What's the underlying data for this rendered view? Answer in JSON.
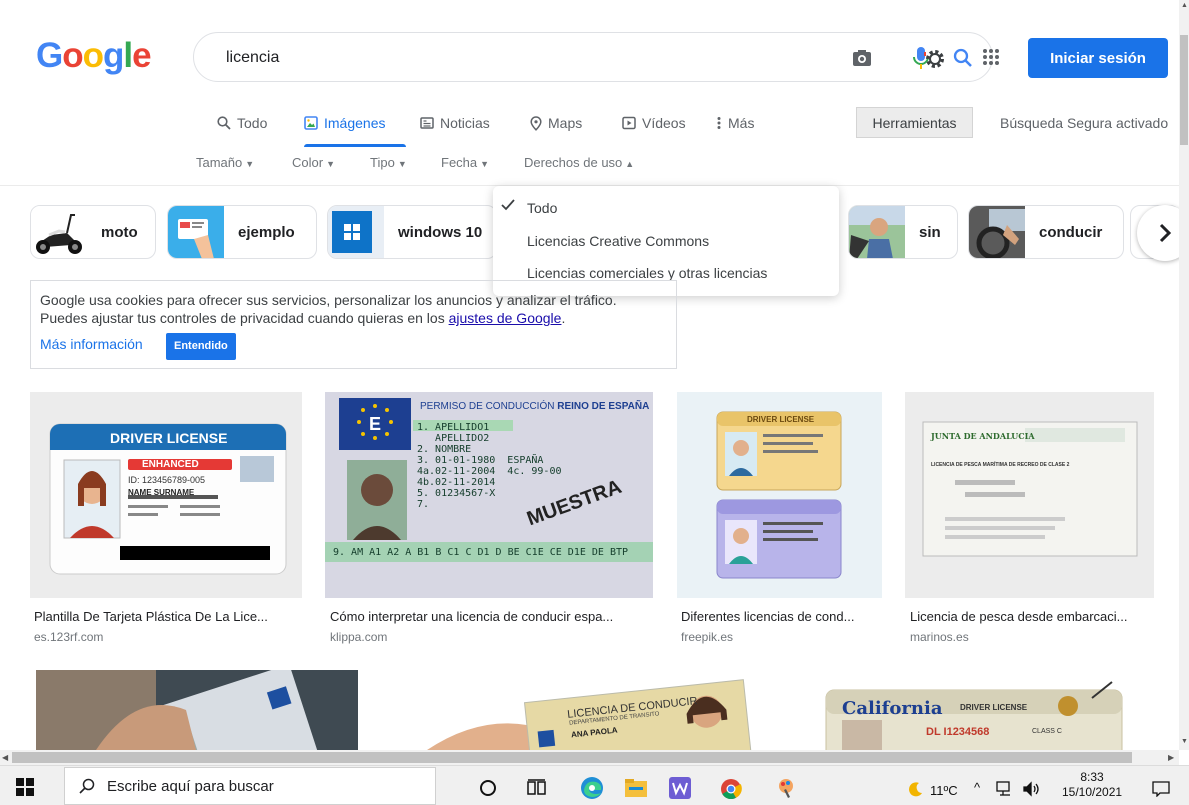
{
  "header": {
    "logo_text": "Google",
    "search_value": "licencia",
    "signin_label": "Iniciar sesión"
  },
  "tabs": [
    {
      "label": "Todo",
      "icon": "search-icon"
    },
    {
      "label": "Imágenes",
      "icon": "image-icon",
      "active": true
    },
    {
      "label": "Noticias",
      "icon": "news-icon"
    },
    {
      "label": "Maps",
      "icon": "map-pin-icon"
    },
    {
      "label": "Vídeos",
      "icon": "video-icon"
    },
    {
      "label": "Más",
      "icon": "more-vert-icon"
    }
  ],
  "tools_label": "Herramientas",
  "safe_search_label": "Búsqueda Segura activado",
  "filters": [
    "Tamaño",
    "Color",
    "Tipo",
    "Fecha",
    "Derechos de uso"
  ],
  "chips": [
    "moto",
    "ejemplo",
    "windows 10",
    "sin",
    "conducir"
  ],
  "usage_rights_menu": {
    "items": [
      "Todo",
      "Licencias Creative Commons",
      "Licencias comerciales y otras licencias"
    ],
    "selected": "Todo"
  },
  "cookie_notice": {
    "line1": "Google usa cookies para ofrecer sus servicios, personalizar los anuncios y analizar el tráfico.",
    "line2_prefix": "Puedes ajustar tus controles de privacidad cuando quieras en los",
    "settings_link": "ajustes de Google",
    "line2_suffix": ".",
    "more_info": "Más información",
    "accept_label": "Entendido"
  },
  "results": [
    {
      "caption": "Plantilla De Tarjeta Plástica De La Lice...",
      "source": "es.123rf.com"
    },
    {
      "caption": "Cómo interpretar una licencia de conducir espa...",
      "source": "klippa.com"
    },
    {
      "caption": "Diferentes licencias de cond...",
      "source": "freepik.es"
    },
    {
      "caption": "Licencia de pesca desde embarcaci...",
      "source": "marinos.es"
    }
  ],
  "image_text": {
    "dl1_title": "DRIVER LICENSE",
    "dl1_badge": "ENHANCED",
    "dl1_id": "ID: 123456789-005",
    "dl1_name": "NAME SURNAME",
    "es_header_left": "PERMISO DE CONDUCCIÓN",
    "es_header_right": "REINO DE ESPAÑA",
    "es_country": "E",
    "es_lines": [
      "1. APELLIDO1",
      "   APELLIDO2",
      "2. NOMBRE",
      "3. 01-01-1980  ESPAÑA",
      "4a.02-11-2004  4c. 99-00",
      "4b.02-11-2014",
      "5. 01234567-X",
      "7."
    ],
    "es_categories": "9. AM A1 A2 A B1 B C1 C D1 D BE C1E CE D1E DE BTP",
    "es_watermark": "MUESTRA",
    "fp_title": "DRIVER LICENSE",
    "ja_org": "JUNTA DE ANDALUCIA",
    "ja_title": "LICENCIA DE PESCA MARÍTIMA DE RECREO DE CLASE 2",
    "co_title1": "LICENCIA DE CONDUCIR",
    "co_title2": "DEPARTAMENTO DE TRANSITO",
    "co_name": "ANA PAOLA",
    "ca_state": "California",
    "ca_title": "DRIVER LICENSE",
    "ca_dl": "DL I1234568",
    "ca_class": "CLASS C"
  },
  "taskbar": {
    "search_placeholder": "Escribe aquí para buscar",
    "weather": "11ºC",
    "time": "8:33",
    "date": "15/10/2021"
  },
  "colors": {
    "accent": "#1a73e8",
    "google_blue": "#4285f4",
    "google_red": "#ea4335",
    "google_yellow": "#fbbc05",
    "google_green": "#34a853"
  }
}
